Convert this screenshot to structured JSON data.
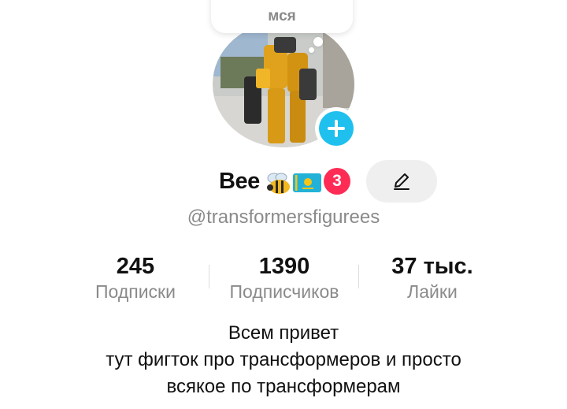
{
  "tooltip": {
    "text": "мся"
  },
  "profile": {
    "name": "Bee",
    "emoji_bee": "🐝",
    "emoji_flag": "🇰🇿",
    "badge_count": "3",
    "handle": "@transformersfigurees"
  },
  "stats": [
    {
      "value": "245",
      "label": "Подписки"
    },
    {
      "value": "1390",
      "label": "Подписчиков"
    },
    {
      "value": "37 тыс.",
      "label": "Лайки"
    }
  ],
  "bio": [
    "Всем привет",
    "тут фигток про трансформеров и просто",
    "всякое по трансформерам"
  ],
  "icons": {
    "add": "plus-icon",
    "edit": "pencil-icon"
  },
  "colors": {
    "accent": "#20c0ee",
    "badge": "#fe2c55",
    "muted": "#8a8a8a"
  }
}
